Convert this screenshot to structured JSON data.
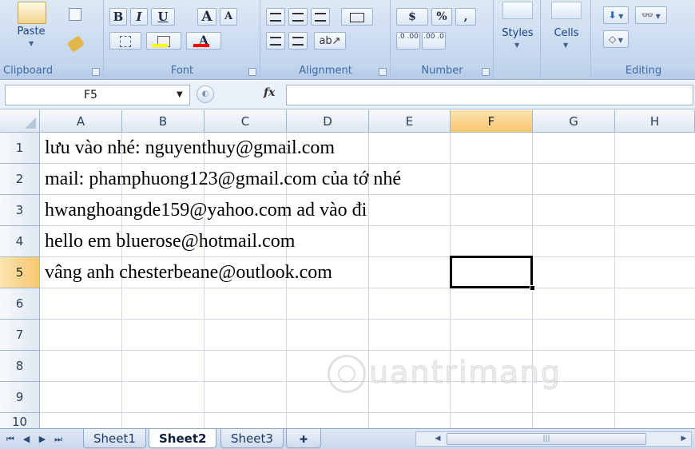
{
  "ribbon": {
    "clipboard": {
      "label": "Clipboard",
      "paste": "Paste"
    },
    "font": {
      "label": "Font",
      "bold": "B",
      "italic": "I",
      "underline": "U",
      "grow": "A",
      "shrink": "A",
      "fill_color": "#ffff00",
      "font_color": "#ff0000"
    },
    "alignment": {
      "label": "Alignment"
    },
    "number": {
      "label": "Number",
      "currency": "$",
      "percent": "%",
      "comma": ",",
      "inc_decimal": ".0 .00",
      "dec_decimal": ".00 .0"
    },
    "styles": {
      "label": "Styles"
    },
    "cells": {
      "label": "Cells"
    },
    "editing": {
      "label": "Editing"
    }
  },
  "formula_bar": {
    "name_box": "F5",
    "fx": "fx",
    "formula": ""
  },
  "grid": {
    "columns": [
      "A",
      "B",
      "C",
      "D",
      "E",
      "F",
      "G",
      "H"
    ],
    "rows": [
      "1",
      "2",
      "3",
      "4",
      "5",
      "6",
      "7",
      "8",
      "9",
      "10"
    ],
    "active_column": "F",
    "active_row": "5",
    "cells": [
      "lưu vào nhé: nguyenthuy@gmail.com",
      "mail: phamphuong123@gmail.com của tớ nhé",
      "hwanghoangde159@yahoo.com ad vào đi",
      "hello em bluerose@hotmail.com",
      "vâng anh chesterbeane@outlook.com"
    ],
    "watermark": "uantrimang"
  },
  "sheets": {
    "tabs": [
      "Sheet1",
      "Sheet2",
      "Sheet3"
    ],
    "active": "Sheet2"
  },
  "colors": {
    "accent": "#15428b",
    "ribbon_bg": "#c9daf0",
    "active_header": "#f8c770",
    "grid_line": "#d0d7e5"
  }
}
